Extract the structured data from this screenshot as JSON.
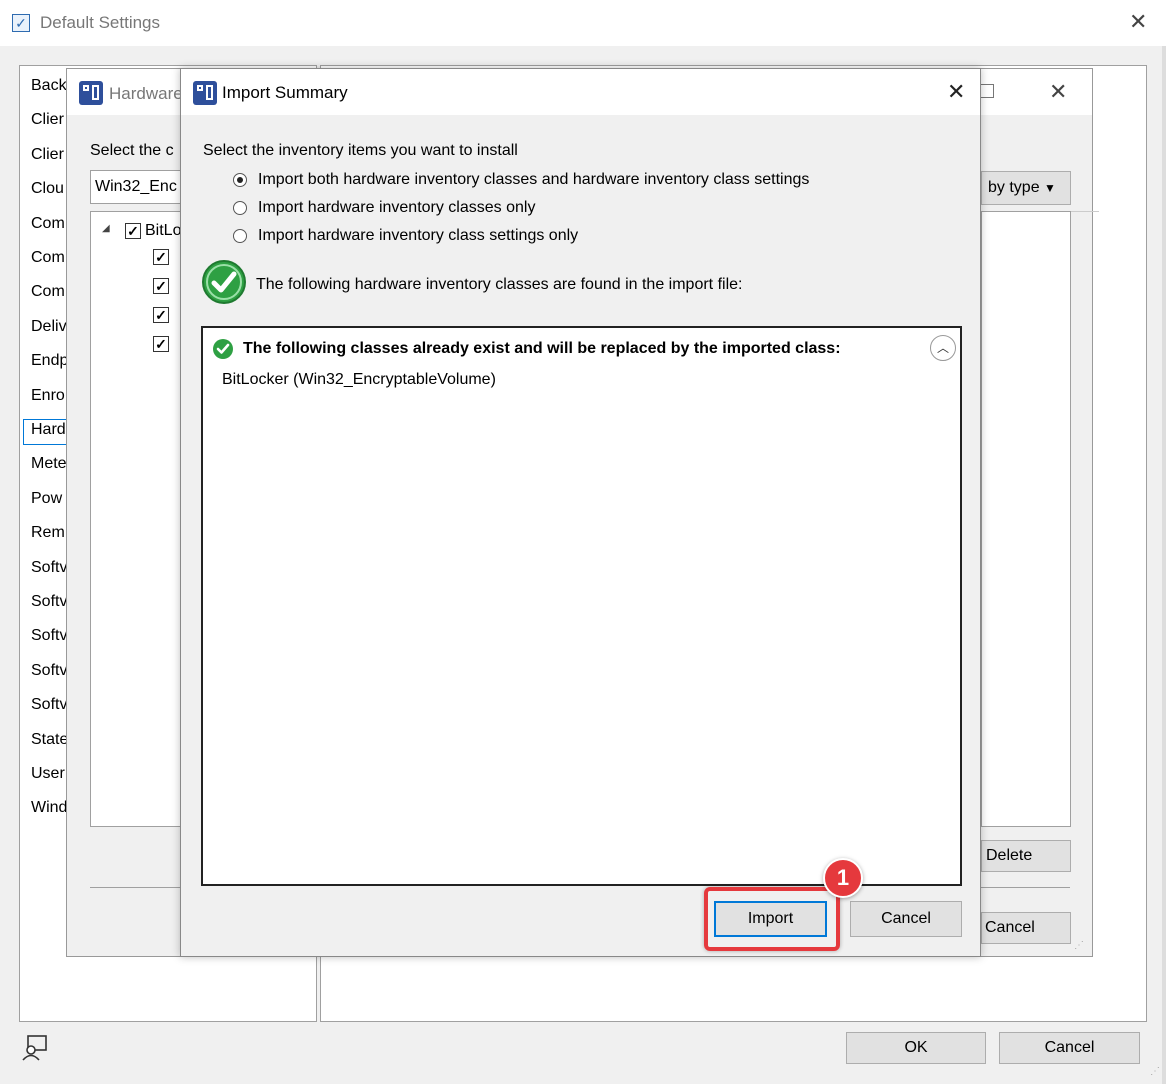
{
  "main_window": {
    "title": "Default Settings",
    "settings_list": [
      "Back",
      "Clier",
      "Clier",
      "Clou",
      "Com",
      "Com",
      "Com",
      "Deliv",
      "Endp",
      "Enro",
      "Hard",
      "Mete",
      "Pow",
      "Rem",
      "Softv",
      "Softv",
      "Softv",
      "Softv",
      "Softv",
      "State",
      "User",
      "Wind"
    ],
    "selected_index": 10,
    "ok_label": "OK",
    "cancel_label": "Cancel"
  },
  "hardware_dialog": {
    "title": "Hardware",
    "select_label": "Select the c",
    "class_input_value": "Win32_Enc",
    "tree_root_label": "BitLo",
    "filter_label": "by type",
    "delete_label": "Delete",
    "cancel_label": "Cancel"
  },
  "import_dialog": {
    "title": "Import Summary",
    "instruction": "Select the inventory items you want to install",
    "options": [
      "Import both hardware inventory classes and hardware inventory class settings",
      "Import hardware inventory classes only",
      "Import hardware inventory class settings only"
    ],
    "selected_option": 0,
    "found_message": "The following hardware inventory classes are found in the import file:",
    "section_header": "The following classes already exist and will be replaced by the imported class:",
    "class_item": "BitLocker (Win32_EncryptableVolume)",
    "import_label": "Import",
    "cancel_label": "Cancel"
  },
  "callout": {
    "number": "1"
  },
  "colors": {
    "accent": "#0078d7",
    "highlight": "#e5393d",
    "success": "#2ea043"
  }
}
